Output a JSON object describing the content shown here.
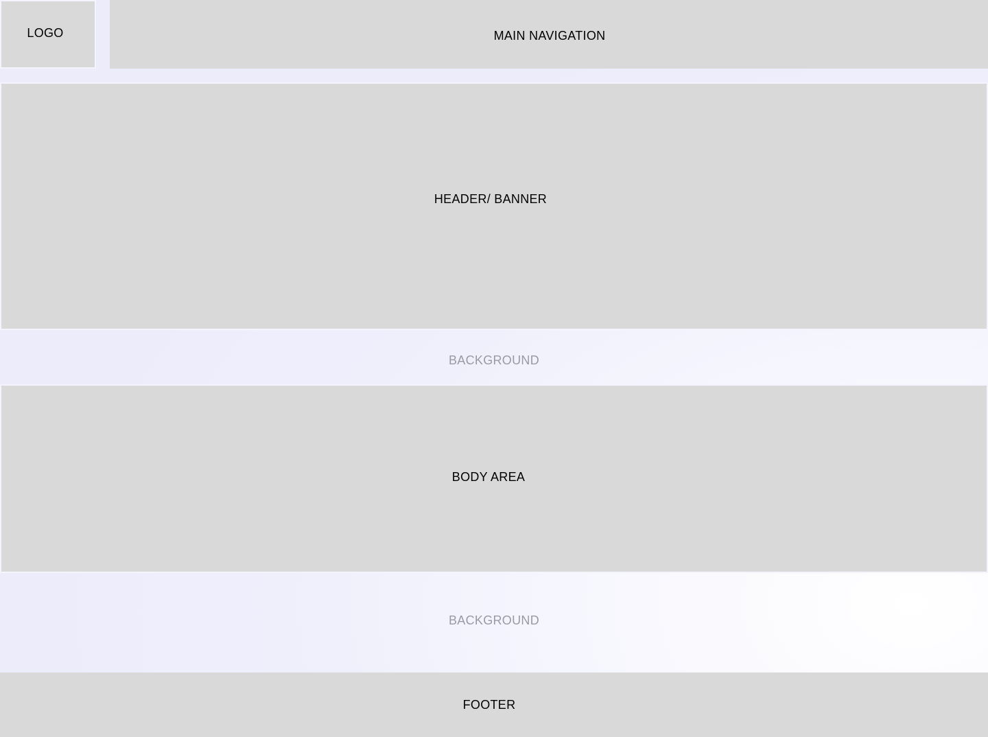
{
  "logo": {
    "label": "LOGO"
  },
  "navigation": {
    "label": "MAIN NAVIGATION"
  },
  "header": {
    "label": "HEADER/ BANNER"
  },
  "background_1": {
    "label": "BACKGROUND"
  },
  "body_area": {
    "label": "BODY AREA"
  },
  "background_2": {
    "label": "BACKGROUND"
  },
  "footer": {
    "label": "FOOTER"
  },
  "colors": {
    "block_fill": "#d9d9d9",
    "page_background": "#efeffc",
    "background_label": "#9a9aa3",
    "text": "#000000"
  }
}
